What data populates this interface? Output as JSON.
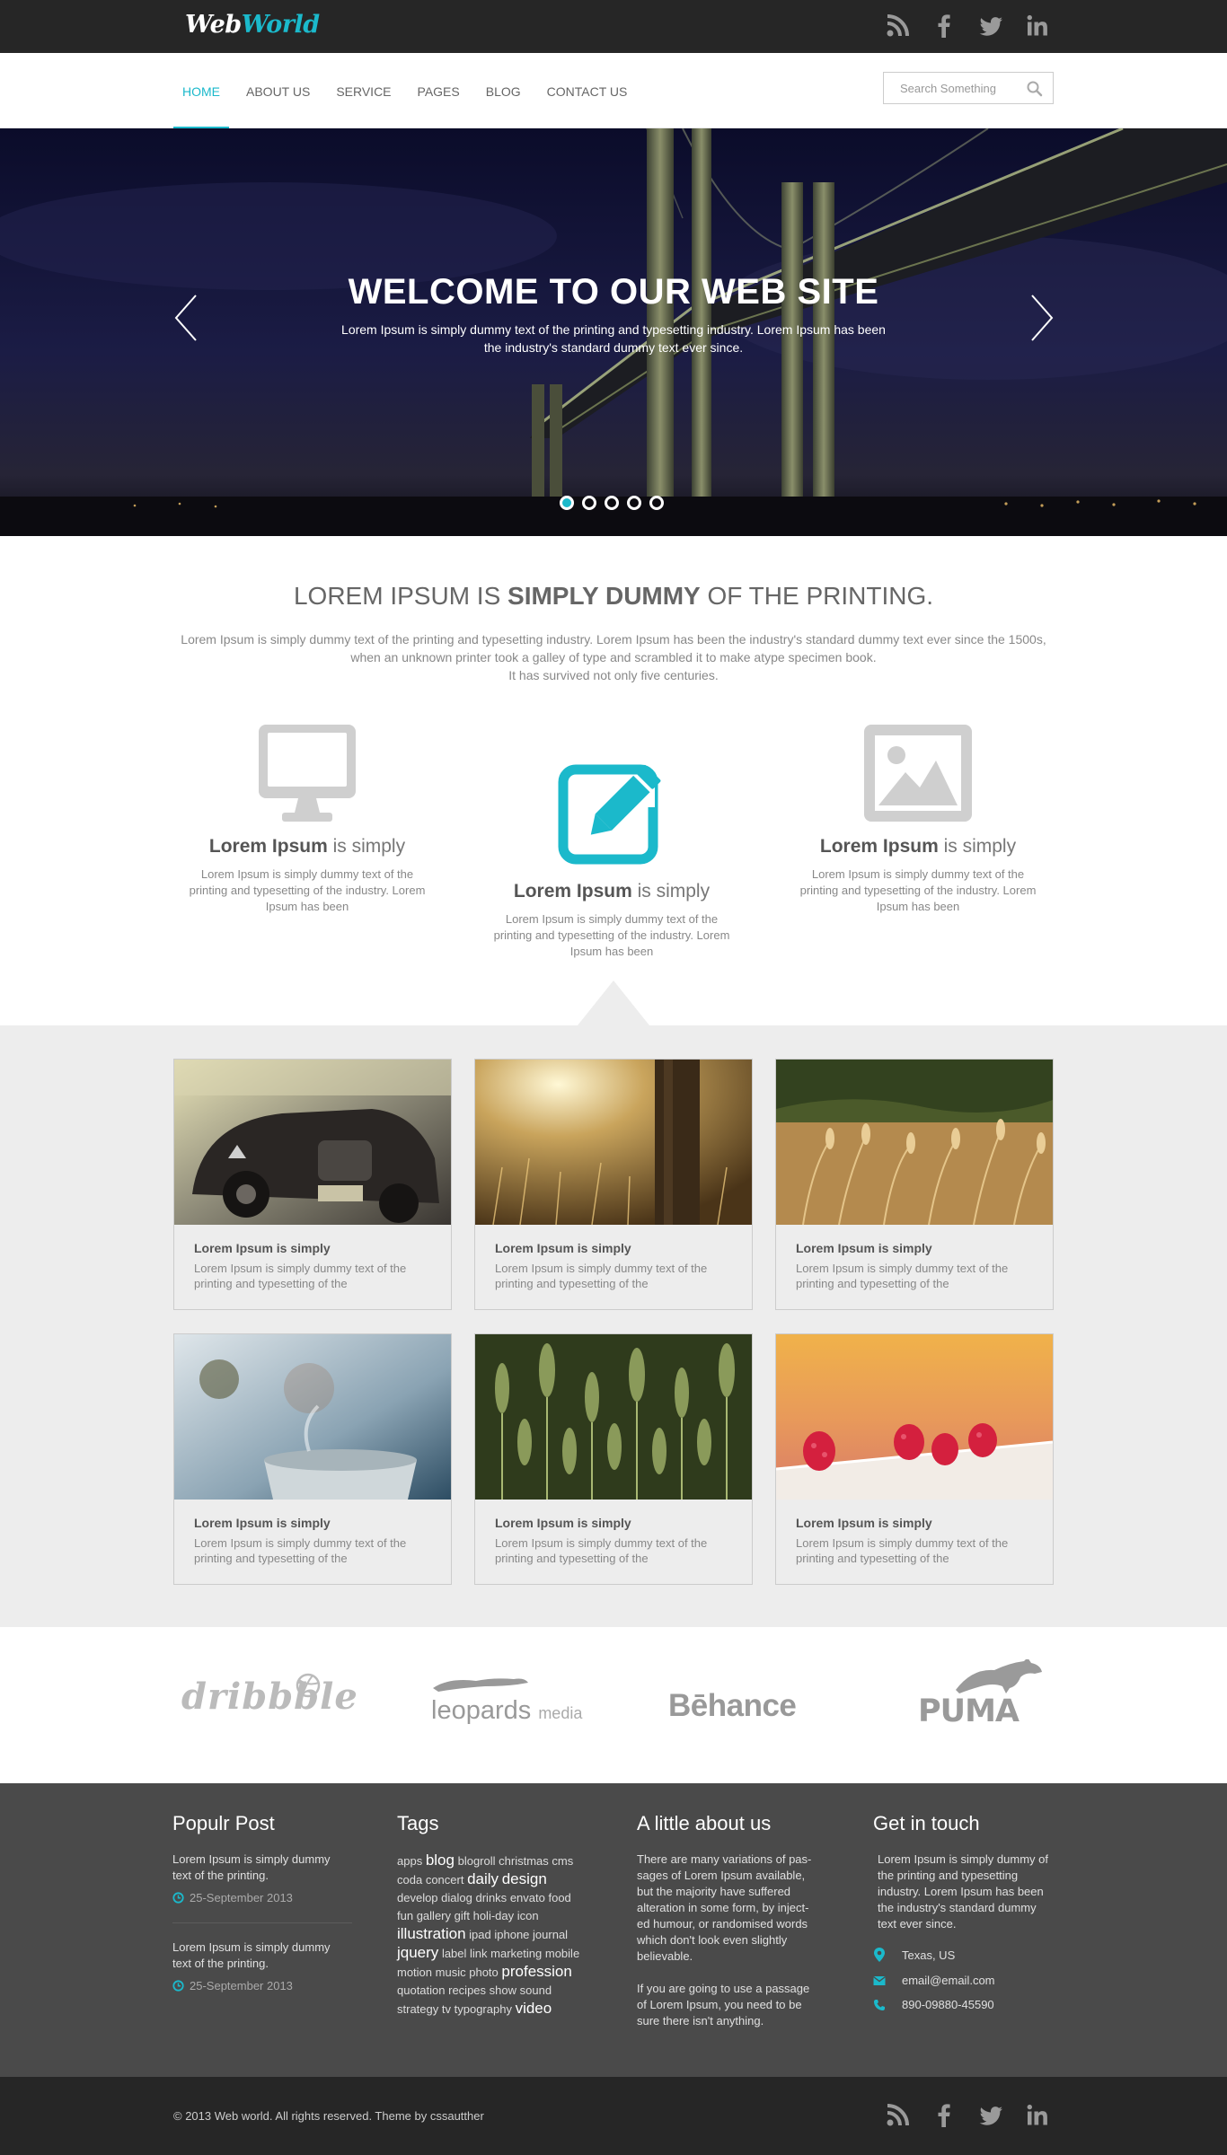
{
  "brand": {
    "name_part1": "Web",
    "name_part2": "World"
  },
  "top_social": [
    "rss-icon",
    "facebook-icon",
    "twitter-icon",
    "linkedin-icon"
  ],
  "nav": {
    "items": [
      "HOME",
      "ABOUT US",
      "SERVICE",
      "PAGES",
      "BLOG",
      "CONTACT US"
    ],
    "active": "HOME",
    "search_placeholder": "Search Something"
  },
  "hero": {
    "title": "WELCOME TO OUR WEB SITE",
    "text": "Lorem Ipsum is simply dummy text of the printing and typesetting industry. Lorem Ipsum has been the industry's standard dummy text ever since.",
    "slide_count": 5,
    "active_slide": 1
  },
  "intro": {
    "title_before": "LOREM IPSUM IS ",
    "title_bold": "SIMPLY DUMMY",
    "title_after": " OF THE PRINTING.",
    "text_line1": "Lorem Ipsum is simply dummy text of the printing and typesetting industry. Lorem Ipsum has been the industry's standard dummy text ever since the 1500s, when an unknown printer took a galley of type and scrambled it to make atype specimen book.",
    "text_line2": "It has survived not only five centuries."
  },
  "features": [
    {
      "icon": "monitor-icon",
      "title_bold": "Lorem Ipsum",
      "title_rest": " is simply",
      "text": "Lorem Ipsum is simply dummy text of the printing and typesetting of the industry. Lorem Ipsum has been"
    },
    {
      "icon": "edit-icon",
      "title_bold": "Lorem Ipsum",
      "title_rest": " is simply",
      "text": "Lorem Ipsum is simply dummy text of the printing and typesetting of the industry. Lorem Ipsum has been"
    },
    {
      "icon": "image-icon",
      "title_bold": "Lorem Ipsum",
      "title_rest": " is simply",
      "text": "Lorem Ipsum is simply dummy text of the printing and typesetting of the industry. Lorem Ipsum has been"
    }
  ],
  "gallery": [
    {
      "image": "vintage-car-photo",
      "title": "Lorem Ipsum is simply",
      "text": "Lorem Ipsum is simply dummy text of the printing and typesetting of the"
    },
    {
      "image": "sunlit-field-photo",
      "title": "Lorem Ipsum is simply",
      "text": "Lorem Ipsum is simply dummy text of the printing and typesetting of the"
    },
    {
      "image": "wheat-field-photo",
      "title": "Lorem Ipsum is simply",
      "text": "Lorem Ipsum is simply dummy text of the printing and typesetting of the"
    },
    {
      "image": "steaming-cup-photo",
      "title": "Lorem Ipsum is simply",
      "text": "Lorem Ipsum is simply dummy text of the printing and typesetting of the"
    },
    {
      "image": "green-wheat-photo",
      "title": "Lorem Ipsum is simply",
      "text": "Lorem Ipsum is simply dummy text of the printing and typesetting of the"
    },
    {
      "image": "raspberries-photo",
      "title": "Lorem Ipsum is simply",
      "text": "Lorem Ipsum is simply dummy text of the printing and typesetting of the"
    }
  ],
  "brands": {
    "dribbble": "dribbble",
    "leopards": "leopards",
    "leopards_suffix": "media",
    "behance": "Bēhance",
    "puma": "PUMA"
  },
  "footer": {
    "popular": {
      "heading": "Populr Post",
      "posts": [
        {
          "text": "Lorem Ipsum is simply dummy text of the printing.",
          "date": "25-September 2013"
        },
        {
          "text": "Lorem Ipsum is simply dummy text of the printing.",
          "date": "25-September 2013"
        }
      ]
    },
    "tags": {
      "heading": "Tags",
      "items": [
        {
          "t": "apps",
          "big": false
        },
        {
          "t": "blog",
          "big": true
        },
        {
          "t": "blogroll",
          "big": false
        },
        {
          "t": "christmas",
          "big": false
        },
        {
          "t": "cms",
          "big": false
        },
        {
          "t": "coda",
          "big": false
        },
        {
          "t": "concert",
          "big": false
        },
        {
          "t": "daily",
          "big": true
        },
        {
          "t": "design",
          "big": true
        },
        {
          "t": "develop",
          "big": false
        },
        {
          "t": "dialog",
          "big": false
        },
        {
          "t": "drinks",
          "big": false
        },
        {
          "t": "envato",
          "big": false
        },
        {
          "t": "food",
          "big": false
        },
        {
          "t": "fun",
          "big": false
        },
        {
          "t": "gallery",
          "big": false
        },
        {
          "t": "gift",
          "big": false
        },
        {
          "t": "holi-day",
          "big": false
        },
        {
          "t": "icon",
          "big": false
        },
        {
          "t": "illustration",
          "big": true
        },
        {
          "t": "ipad",
          "big": false
        },
        {
          "t": "iphone",
          "big": false
        },
        {
          "t": "journal",
          "big": false
        },
        {
          "t": "jquery",
          "big": true
        },
        {
          "t": "label",
          "big": false
        },
        {
          "t": "link",
          "big": false
        },
        {
          "t": "marketing",
          "big": false
        },
        {
          "t": "mobile",
          "big": false
        },
        {
          "t": "motion",
          "big": false
        },
        {
          "t": "music",
          "big": false
        },
        {
          "t": "photo",
          "big": false
        },
        {
          "t": "profession",
          "big": true
        },
        {
          "t": "quotation",
          "big": false
        },
        {
          "t": "recipes",
          "big": false
        },
        {
          "t": "show",
          "big": false
        },
        {
          "t": "sound",
          "big": false
        },
        {
          "t": "strategy",
          "big": false
        },
        {
          "t": "tv",
          "big": false
        },
        {
          "t": "typography",
          "big": false
        },
        {
          "t": "video",
          "big": true
        }
      ]
    },
    "about": {
      "heading": "A little about us",
      "p1": "There are many variations of pas-sages of Lorem Ipsum available, but the majority have suffered alteration in some form, by inject-ed humour, or randomised words which don't look even slightly believable.",
      "p2": "If you are going to use a passage of Lorem Ipsum, you need to be sure there isn't anything."
    },
    "contact": {
      "heading": "Get in touch",
      "text": "Lorem Ipsum is simply dummy of the printing and typesetting industry. Lorem Ipsum has been the industry's standard dummy text ever since.",
      "location": "Texas, US",
      "email": "email@email.com",
      "phone": "890-09880-45590"
    },
    "copyright": "© 2013 Web world. All rights reserved. Theme by cssautther"
  },
  "colors": {
    "accent": "#1bb9cb",
    "dark_bar": "#262626",
    "footer_bg": "#4a4a4a",
    "gallery_bg": "#ededed"
  }
}
